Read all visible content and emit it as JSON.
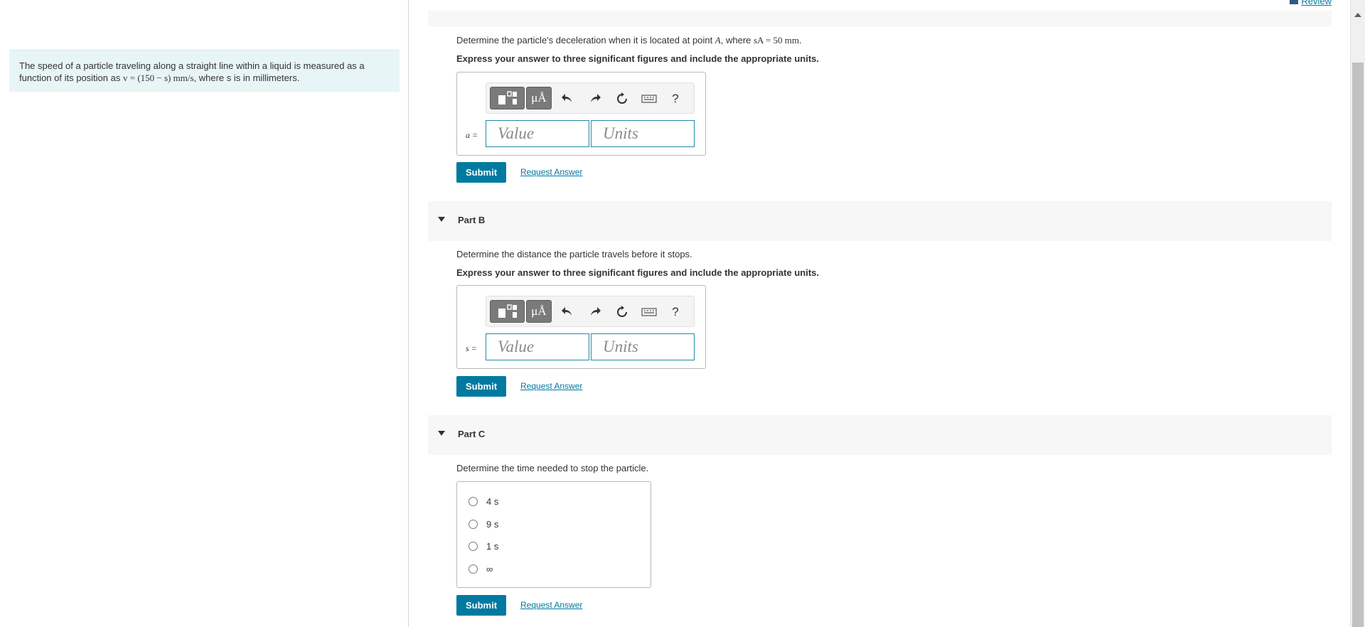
{
  "problem": {
    "text_pre": "The speed of a particle traveling along a straight line within a liquid is measured as a function of its position as ",
    "formula": "v = (150 − s) mm/s",
    "text_post": ", where s is in millimeters."
  },
  "header": {
    "review_label": "Review"
  },
  "part_a": {
    "prompt_pre": "Determine the particle's deceleration when it is located at point ",
    "prompt_point": "A",
    "prompt_mid": ", where ",
    "prompt_math": "sA = 50 mm",
    "prompt_end": ".",
    "instruction": "Express your answer to three significant figures and include the appropriate units.",
    "field_label": "a =",
    "value_placeholder": "Value",
    "units_placeholder": "Units",
    "submit_label": "Submit",
    "request_label": "Request Answer"
  },
  "part_b": {
    "title": "Part B",
    "prompt": "Determine the distance the particle travels before it stops.",
    "instruction": "Express your answer to three significant figures and include the appropriate units.",
    "field_label": "s =",
    "value_placeholder": "Value",
    "units_placeholder": "Units",
    "submit_label": "Submit",
    "request_label": "Request Answer"
  },
  "part_c": {
    "title": "Part C",
    "prompt": "Determine the time needed to stop the particle.",
    "choices": [
      "4 s",
      "9 s",
      "1 s",
      "∞"
    ],
    "submit_label": "Submit",
    "request_label": "Request Answer"
  },
  "toolbar": {
    "units_button_label": "μÅ",
    "help_label": "?",
    "icons": [
      "templates-icon",
      "units-icon",
      "undo-icon",
      "redo-icon",
      "reset-icon",
      "keyboard-icon",
      "help-icon"
    ]
  }
}
